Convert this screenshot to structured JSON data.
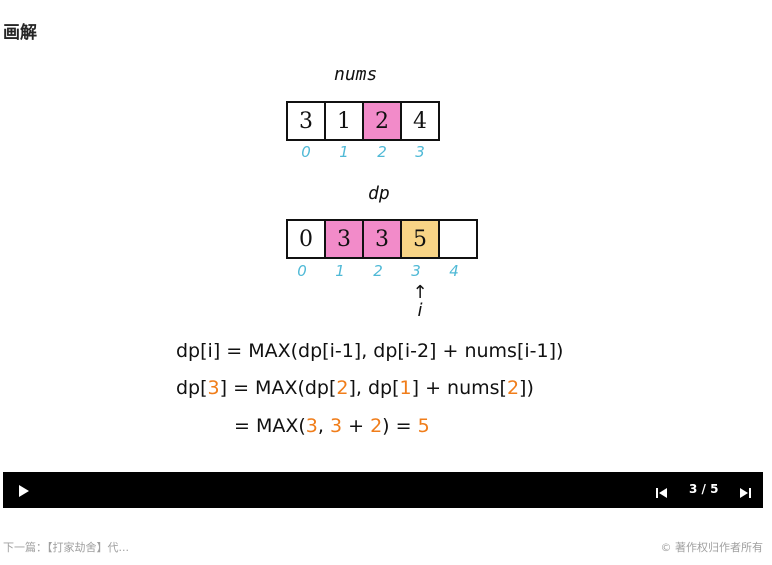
{
  "section_title": "画解",
  "nums": {
    "label": "nums",
    "values": [
      "3",
      "1",
      "2",
      "4"
    ],
    "highlight_index": 2,
    "indices": [
      "0",
      "1",
      "2",
      "3"
    ]
  },
  "dp": {
    "label": "dp",
    "values": [
      "0",
      "3",
      "3",
      "5",
      ""
    ],
    "indices": [
      "0",
      "1",
      "2",
      "3",
      "4"
    ],
    "pointer_arrow": "↑",
    "pointer_label": "i"
  },
  "formulas": {
    "line1": "dp[i] = MAX(dp[i-1], dp[i-2] + nums[i-1])",
    "line2_a": "dp[",
    "line2_b": "3",
    "line2_c": "] = MAX(dp[",
    "line2_d": "2",
    "line2_e": "], dp[",
    "line2_f": "1",
    "line2_g": "] + nums[",
    "line2_h": "2",
    "line2_i": "])",
    "line3_a": "= MAX(",
    "line3_b": "3",
    "line3_c": ", ",
    "line3_d": "3",
    "line3_e": " + ",
    "line3_f": "2",
    "line3_g": ") = ",
    "line3_h": "5"
  },
  "player": {
    "page_indicator": "3 / 5",
    "play_icon": "play-icon",
    "prev_icon": "skip-previous-icon",
    "next_icon": "skip-next-icon"
  },
  "footer": {
    "prev_link": "下一篇：【打家劫舍】代...",
    "copyright": "© 著作权归作者所有"
  },
  "colors": {
    "pink": "#f28bc9",
    "yellow": "#f8d486",
    "index_blue": "#4fb9d6",
    "orange": "#f07d1a",
    "player_bg": "#000000"
  }
}
